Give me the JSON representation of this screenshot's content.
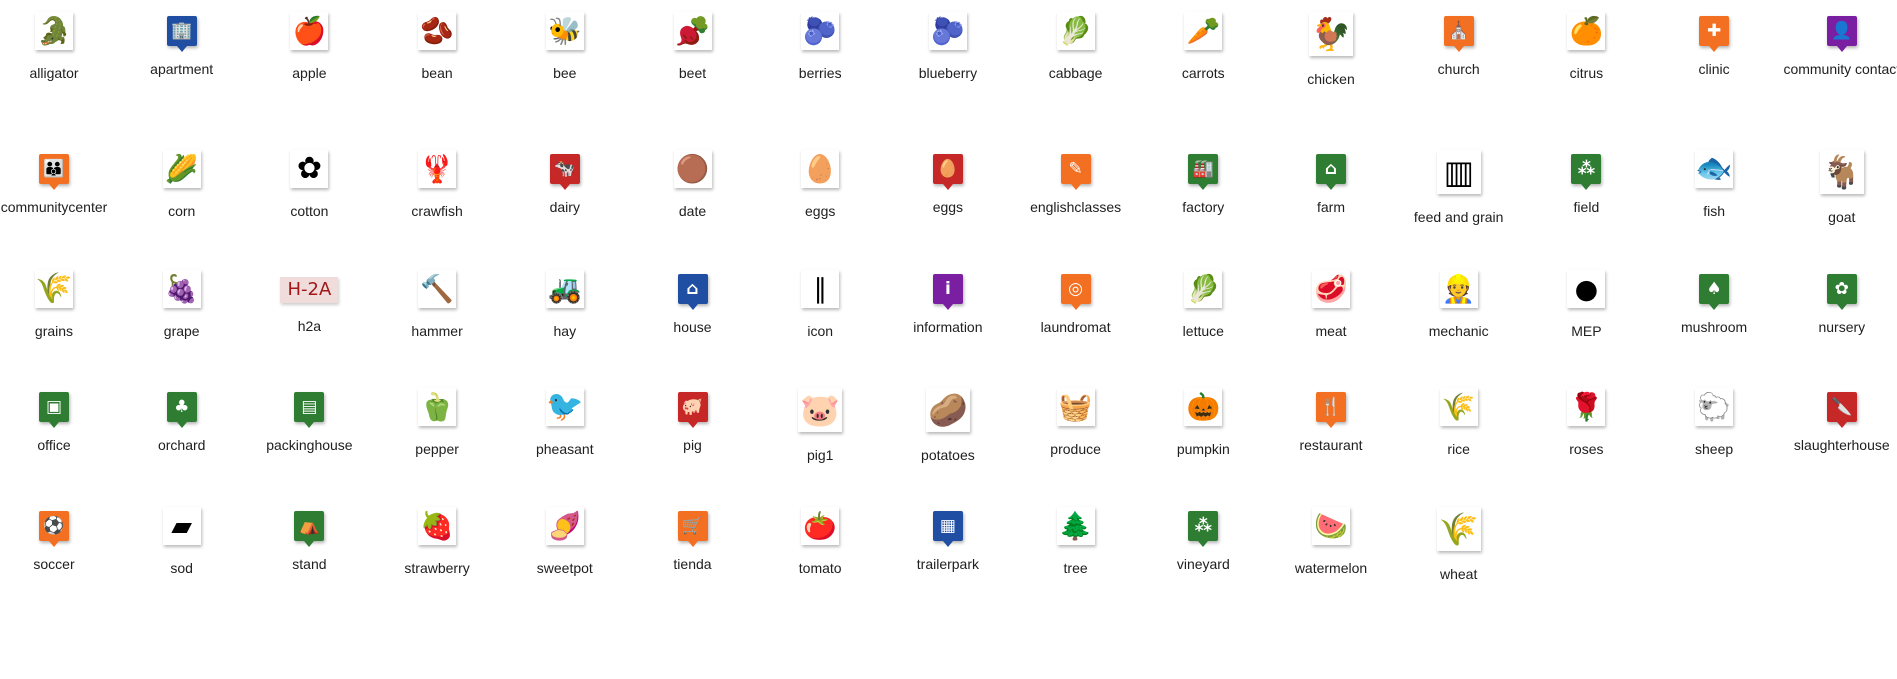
{
  "colors": {
    "orange": "#f36f21",
    "blue": "#1f4ea3",
    "green": "#2e7d32",
    "red": "#c62828",
    "purple": "#7b1fa2"
  },
  "icons": [
    {
      "name": "alligator",
      "icon": "alligator-icon",
      "glyph": "🐊"
    },
    {
      "name": "apartment",
      "icon": "apartment-icon",
      "glyph": "🏢",
      "marker": "#1f4ea3"
    },
    {
      "name": "apple",
      "icon": "apple-icon",
      "glyph": "🍎"
    },
    {
      "name": "bean",
      "icon": "bean-icon",
      "glyph": "🫘"
    },
    {
      "name": "bee",
      "icon": "bee-icon",
      "glyph": "🐝"
    },
    {
      "name": "beet",
      "icon": "beet-icon",
      "glyph": "🫜"
    },
    {
      "name": "berries",
      "icon": "berries-icon",
      "glyph": "🫐"
    },
    {
      "name": "blueberry",
      "icon": "blueberry-icon",
      "glyph": "🫐"
    },
    {
      "name": "cabbage",
      "icon": "cabbage-icon",
      "glyph": "🥬"
    },
    {
      "name": "carrots",
      "icon": "carrot-icon",
      "glyph": "🥕"
    },
    {
      "name": "chicken",
      "icon": "chicken-icon",
      "glyph": "🐓",
      "style": "dark big"
    },
    {
      "name": "church",
      "icon": "church-icon",
      "glyph": "⛪",
      "marker": "#f36f21"
    },
    {
      "name": "citrus",
      "icon": "orange-icon",
      "glyph": "🍊"
    },
    {
      "name": "clinic",
      "icon": "clinic-icon",
      "glyph": "✚",
      "marker": "#f36f21"
    },
    {
      "name": "community contact",
      "icon": "person-icon",
      "glyph": "👤",
      "marker": "#7b1fa2"
    },
    {
      "name": "communitycenter",
      "icon": "community-icon",
      "glyph": "👪",
      "marker": "#f36f21"
    },
    {
      "name": "corn",
      "icon": "corn-icon",
      "glyph": "🌽"
    },
    {
      "name": "cotton",
      "icon": "cotton-icon",
      "glyph": "✿",
      "style": "dark"
    },
    {
      "name": "crawfish",
      "icon": "crawfish-icon",
      "glyph": "🦞"
    },
    {
      "name": "dairy",
      "icon": "cow-icon",
      "glyph": "🐄",
      "marker": "#c62828"
    },
    {
      "name": "date",
      "icon": "date-fruit-icon",
      "glyph": "🟤"
    },
    {
      "name": "eggs",
      "icon": "eggs-icon",
      "glyph": "🥚"
    },
    {
      "name": "eggs",
      "icon": "eggs-marker-icon",
      "glyph": "🥚",
      "marker": "#c62828"
    },
    {
      "name": "englishclasses",
      "icon": "teacher-icon",
      "glyph": "✎",
      "marker": "#f36f21"
    },
    {
      "name": "factory",
      "icon": "factory-icon",
      "glyph": "🏭",
      "marker": "#2e7d32"
    },
    {
      "name": "farm",
      "icon": "farm-icon",
      "glyph": "⌂",
      "marker": "#2e7d32"
    },
    {
      "name": "feed and grain",
      "icon": "silo-icon",
      "glyph": "▥",
      "style": "dark big"
    },
    {
      "name": "field",
      "icon": "field-icon",
      "glyph": "⁂",
      "marker": "#2e7d32"
    },
    {
      "name": "fish",
      "icon": "fish-icon",
      "glyph": "🐟",
      "style": "dark"
    },
    {
      "name": "goat",
      "icon": "goat-icon",
      "glyph": "🐐",
      "style": "dark big"
    },
    {
      "name": "grains",
      "icon": "grains-icon",
      "glyph": "🌾",
      "style": "dark"
    },
    {
      "name": "grape",
      "icon": "grape-icon",
      "glyph": "🍇"
    },
    {
      "name": "h2a",
      "icon": "h2a-badge-icon",
      "glyph": "H-2A",
      "style": "text-badge"
    },
    {
      "name": "hammer",
      "icon": "hammer-icon",
      "glyph": "🔨"
    },
    {
      "name": "hay",
      "icon": "hay-truck-icon",
      "glyph": "🚜"
    },
    {
      "name": "house",
      "icon": "house-icon",
      "glyph": "⌂",
      "marker": "#1f4ea3"
    },
    {
      "name": "icon",
      "icon": "asparagus-icon",
      "glyph": "∥"
    },
    {
      "name": "information",
      "icon": "information-icon",
      "glyph": "i",
      "marker": "#7b1fa2"
    },
    {
      "name": "laundromat",
      "icon": "washer-icon",
      "glyph": "◎",
      "marker": "#f36f21"
    },
    {
      "name": "lettuce",
      "icon": "lettuce-icon",
      "glyph": "🥬"
    },
    {
      "name": "meat",
      "icon": "meat-icon",
      "glyph": "🥩"
    },
    {
      "name": "mechanic",
      "icon": "mechanic-icon",
      "glyph": "👷"
    },
    {
      "name": "MEP",
      "icon": "mep-flag-icon",
      "glyph": "●"
    },
    {
      "name": "mushroom",
      "icon": "mushroom-icon",
      "glyph": "♠",
      "marker": "#2e7d32"
    },
    {
      "name": "nursery",
      "icon": "nursery-icon",
      "glyph": "✿",
      "marker": "#2e7d32"
    },
    {
      "name": "office",
      "icon": "office-icon",
      "glyph": "▣",
      "marker": "#2e7d32"
    },
    {
      "name": "orchard",
      "icon": "orchard-icon",
      "glyph": "♣",
      "marker": "#2e7d32"
    },
    {
      "name": "packinghouse",
      "icon": "forklift-icon",
      "glyph": "▤",
      "marker": "#2e7d32"
    },
    {
      "name": "pepper",
      "icon": "pepper-icon",
      "glyph": "🫑"
    },
    {
      "name": "pheasant",
      "icon": "pheasant-icon",
      "glyph": "🐦",
      "style": "dark"
    },
    {
      "name": "pig",
      "icon": "pig-marker-icon",
      "glyph": "🐖",
      "marker": "#c62828"
    },
    {
      "name": "pig1",
      "icon": "pig-face-icon",
      "glyph": "🐷",
      "style": "big"
    },
    {
      "name": "potatoes",
      "icon": "potatoes-icon",
      "glyph": "🥔",
      "style": "big"
    },
    {
      "name": "produce",
      "icon": "produce-crate-icon",
      "glyph": "🧺"
    },
    {
      "name": "pumpkin",
      "icon": "pumpkin-icon",
      "glyph": "🎃"
    },
    {
      "name": "restaurant",
      "icon": "restaurant-icon",
      "glyph": "🍴",
      "marker": "#f36f21"
    },
    {
      "name": "rice",
      "icon": "rice-icon",
      "glyph": "🌾"
    },
    {
      "name": "roses",
      "icon": "rose-icon",
      "glyph": "🌹"
    },
    {
      "name": "sheep",
      "icon": "sheep-icon",
      "glyph": "🐑"
    },
    {
      "name": "slaughterhouse",
      "icon": "cleaver-icon",
      "glyph": "🔪",
      "marker": "#c62828"
    },
    {
      "name": "soccer",
      "icon": "soccer-icon",
      "glyph": "⚽",
      "marker": "#f36f21"
    },
    {
      "name": "sod",
      "icon": "sod-icon",
      "glyph": "▰"
    },
    {
      "name": "stand",
      "icon": "stand-icon",
      "glyph": "⛺",
      "marker": "#2e7d32"
    },
    {
      "name": "strawberry",
      "icon": "strawberry-icon",
      "glyph": "🍓"
    },
    {
      "name": "sweetpot",
      "icon": "sweet-potato-icon",
      "glyph": "🍠"
    },
    {
      "name": "tienda",
      "icon": "cart-icon",
      "glyph": "🛒",
      "marker": "#f36f21"
    },
    {
      "name": "tomato",
      "icon": "tomato-icon",
      "glyph": "🍅"
    },
    {
      "name": "trailerpark",
      "icon": "trailer-icon",
      "glyph": "▦",
      "marker": "#1f4ea3"
    },
    {
      "name": "tree",
      "icon": "tree-icon",
      "glyph": "🌲"
    },
    {
      "name": "vineyard",
      "icon": "vineyard-icon",
      "glyph": "⁂",
      "marker": "#2e7d32"
    },
    {
      "name": "watermelon",
      "icon": "watermelon-icon",
      "glyph": "🍉"
    },
    {
      "name": "wheat",
      "icon": "wheat-icon",
      "glyph": "🌾",
      "style": "big"
    }
  ]
}
